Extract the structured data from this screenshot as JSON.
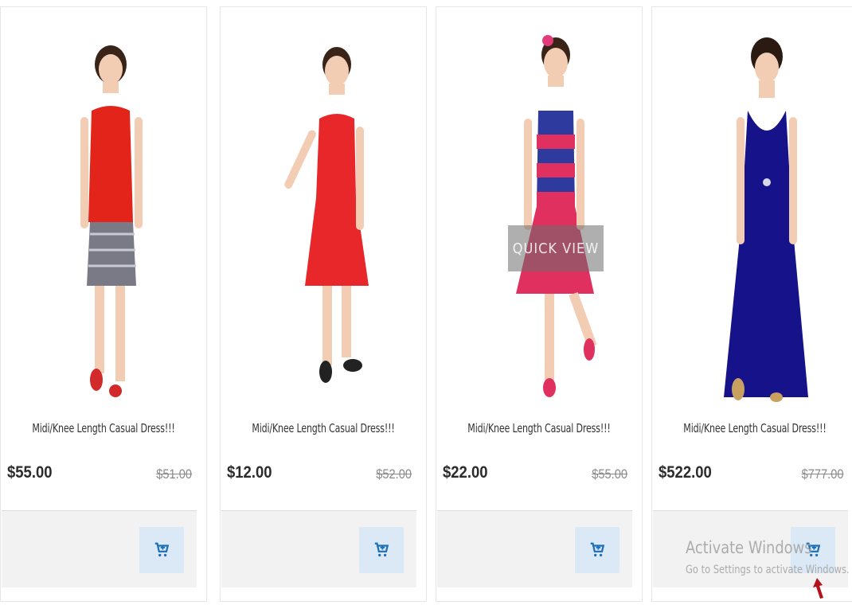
{
  "products": [
    {
      "title": "Midi/Knee Length Casual Dress!!!",
      "price": "$55.00",
      "old_price": "$51.00",
      "dress_color": "#e3241b",
      "skirt_color": "#6b6b7a"
    },
    {
      "title": "Midi/Knee Length Casual Dress!!!",
      "price": "$12.00",
      "old_price": "$52.00",
      "dress_color": "#e8272a",
      "skirt_color": "#e8272a"
    },
    {
      "title": "Midi/Knee Length Casual Dress!!!",
      "price": "$22.00",
      "old_price": "$55.00",
      "dress_color": "#e0305f",
      "skirt_color": "#e0305f",
      "quick_view_label": "QUICK VIEW"
    },
    {
      "title": "Midi/Knee Length Casual Dress!!!",
      "price": "$522.00",
      "old_price": "$777.00",
      "dress_color": "#16128a",
      "skirt_color": "#16128a"
    }
  ],
  "cart_icon": "cart-plus-icon",
  "accent_color": "#1a6fb8",
  "watermark": {
    "title": "Activate Windows",
    "subtitle": "Go to Settings to activate Windows."
  }
}
